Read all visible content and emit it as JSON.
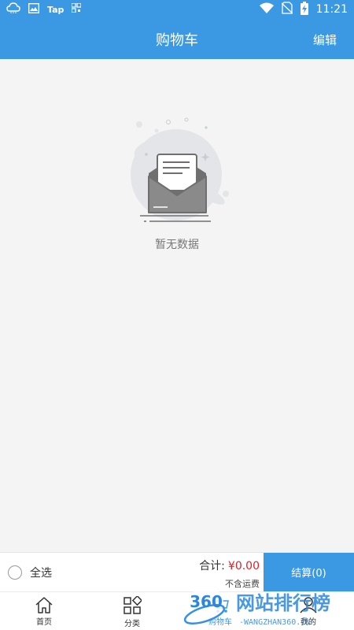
{
  "status_bar": {
    "tap_label": "Tap",
    "time": "11:21",
    "battery_icon": "battery-charging-icon",
    "colors": {
      "bar": "#3b99e4",
      "text": "#ffffff"
    }
  },
  "header": {
    "title": "购物车",
    "edit_label": "编辑"
  },
  "empty_state": {
    "icon": "empty-envelope-icon",
    "text": "暂无数据"
  },
  "cart_bar": {
    "select_all_label": "全选",
    "total_label": "合计:",
    "total_amount": "¥0.00",
    "shipping_note": "不含运费",
    "checkout_label": "结算(0)"
  },
  "tabs": [
    {
      "label": "首页",
      "icon": "home-icon"
    },
    {
      "label": "分类",
      "icon": "category-grid-icon"
    },
    {
      "label": "购物车",
      "icon": "cart-icon"
    },
    {
      "label": "我的",
      "icon": "user-icon"
    }
  ],
  "watermark": {
    "logo_text": "360",
    "title": "网站排行榜",
    "subtitle": "-WANGZHAN360.CN-"
  },
  "colors": {
    "primary": "#3b99e4",
    "price": "#e51c23",
    "background": "#f4f4f4"
  }
}
